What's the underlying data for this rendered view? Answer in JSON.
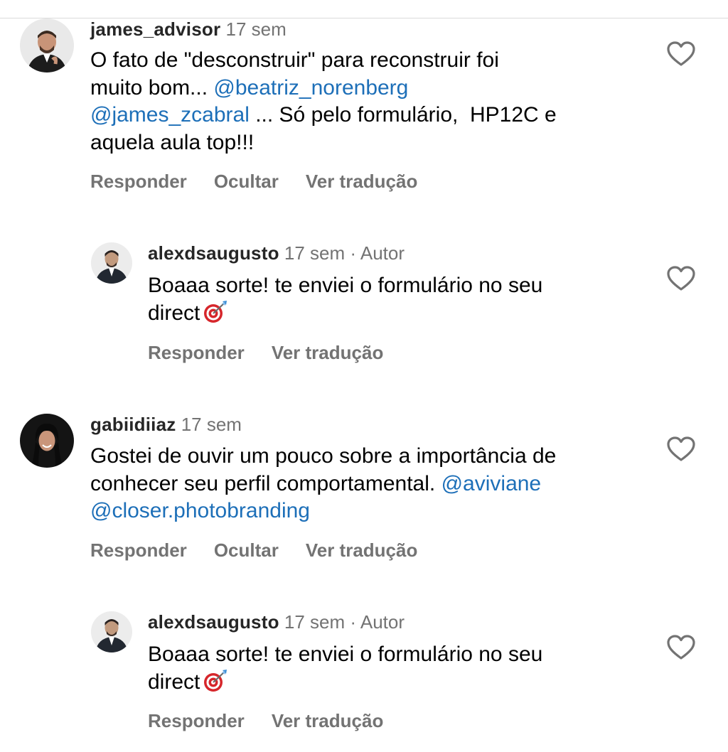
{
  "comments": [
    {
      "username": "james_advisor",
      "time": "17 sem",
      "segments": [
        {
          "text": "O fato de \"desconstruir\" para reconstruir foi\nmuito bom... "
        },
        {
          "text": "@beatriz_norenberg",
          "mention": true
        },
        {
          "text": "\n"
        },
        {
          "text": "@james_zcabral",
          "mention": true
        },
        {
          "text": " ... Só pelo formulário,  HP12C e\naquela aula top!!!"
        }
      ],
      "actions": [
        "Responder",
        "Ocultar",
        "Ver tradução"
      ]
    },
    {
      "username": "alexdsaugusto",
      "time": "17 sem",
      "dot": "·",
      "author_label": "Autor",
      "segments": [
        {
          "text": "Boaaa sorte! te enviei o formulário no seu\ndirect"
        }
      ],
      "emoji": "direct-hit-emoji",
      "actions": [
        "Responder",
        "Ver tradução"
      ]
    },
    {
      "username": "gabiidiiaz",
      "time": "17 sem",
      "segments": [
        {
          "text": "Gostei de ouvir um pouco sobre a importância de\nconhecer seu perfil comportamental. "
        },
        {
          "text": "@aviviane",
          "mention": true
        },
        {
          "text": "\n"
        },
        {
          "text": "@closer.photobranding",
          "mention": true
        }
      ],
      "actions": [
        "Responder",
        "Ocultar",
        "Ver tradução"
      ]
    },
    {
      "username": "alexdsaugusto",
      "time": "17 sem",
      "dot": "·",
      "author_label": "Autor",
      "segments": [
        {
          "text": "Boaaa sorte! te enviei o formulário no seu\ndirect"
        }
      ],
      "emoji": "direct-hit-emoji",
      "actions": [
        "Responder",
        "Ver tradução"
      ]
    }
  ],
  "colors": {
    "mention": "#1d6fb8",
    "secondary_text": "#737373",
    "username": "#262626"
  },
  "icons": {
    "like": "heart-outline-icon"
  }
}
